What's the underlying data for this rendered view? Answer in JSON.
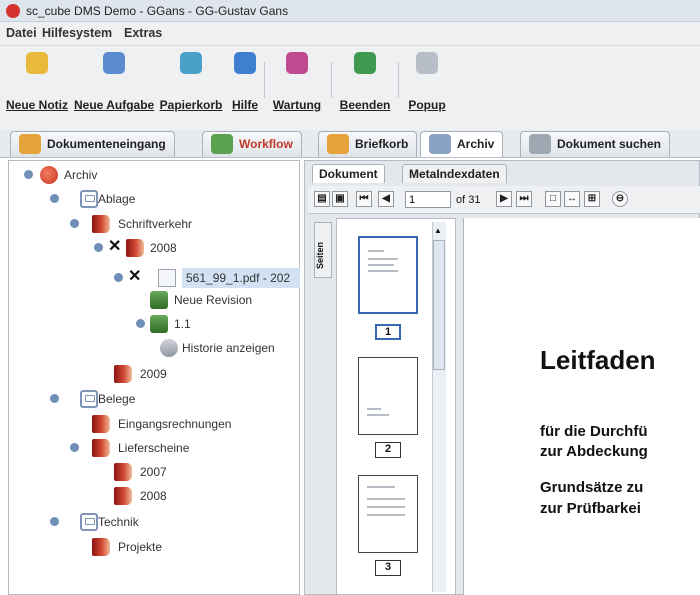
{
  "window": {
    "title": "sc_cube DMS Demo - GGans - GG-Gustav Gans"
  },
  "menu": [
    "Datei",
    "Hilfesystem",
    "Extras"
  ],
  "toolbar": {
    "buttons": [
      {
        "label": "Neue Notiz",
        "icon": "note-icon",
        "color": "#e8b93a"
      },
      {
        "label": "Neue Aufgabe",
        "icon": "task-icon",
        "color": "#5a8bd0"
      },
      {
        "label": "Papierkorb",
        "icon": "trash-icon",
        "color": "#4aa0c8"
      },
      {
        "label": "Hilfe",
        "icon": "help-icon",
        "color": "#3f7fd0"
      },
      {
        "label": "Wartung",
        "icon": "maintenance-icon",
        "color": "#c04a8f"
      },
      {
        "label": "Beenden",
        "icon": "exit-icon",
        "color": "#3f9a4f"
      },
      {
        "label": "Popup",
        "icon": "popup-icon",
        "color": "#b8bec8"
      }
    ]
  },
  "tabs": [
    {
      "label": "Dokumenteneingang",
      "icon": "inbox-icon",
      "color": "#e4a23a"
    },
    {
      "label": "Workflow",
      "icon": "workflow-icon",
      "color": "#5ca14d"
    },
    {
      "label": "Briefkorb",
      "icon": "letterbox-icon",
      "color": "#e7a13a"
    },
    {
      "label": "Archiv",
      "icon": "archive-icon",
      "color": "#8aa3c5"
    },
    {
      "label": "Dokument suchen",
      "icon": "search-icon",
      "color": "#9ea8b3"
    }
  ],
  "tree": {
    "nodes": [
      {
        "label": "Archiv",
        "icon": "root",
        "expander": true
      },
      {
        "label": "Ablage",
        "icon": "box",
        "expander": true
      },
      {
        "label": "Schriftverkehr",
        "icon": "folder",
        "expander": true
      },
      {
        "label": "2008",
        "icon": "folder",
        "expander": true,
        "mark": "✕"
      },
      {
        "label": "561_99_1.pdf - 202",
        "icon": "doc",
        "expander": true,
        "mark": "✕",
        "selected": true
      },
      {
        "label": "Neue Revision",
        "icon": "rev"
      },
      {
        "label": "1.1",
        "icon": "rev",
        "expander": true
      },
      {
        "label": "Historie anzeigen",
        "icon": "hist"
      },
      {
        "label": "2009",
        "icon": "folder"
      },
      {
        "label": "Belege",
        "icon": "box",
        "expander": true
      },
      {
        "label": "Eingangsrechnungen",
        "icon": "folder"
      },
      {
        "label": "Lieferscheine",
        "icon": "folder",
        "expander": true
      },
      {
        "label": "2007",
        "icon": "folder"
      },
      {
        "label": "2008",
        "icon": "folder"
      },
      {
        "label": "Technik",
        "icon": "box",
        "expander": true
      },
      {
        "label": "Projekte",
        "icon": "folder"
      }
    ]
  },
  "viewer": {
    "tabs": [
      "Dokument",
      "MetaIndexdaten"
    ],
    "page_input": "1",
    "page_of": "of 31",
    "side_tab": "Seiten",
    "thumbnails": [
      "1",
      "2",
      "3"
    ],
    "selected_page": "1",
    "doc": {
      "heading": "Leitfaden",
      "lines": [
        "für die Durchfü",
        "zur Abdeckung",
        "Grundsätze zu",
        "zur Prüfbarkei"
      ]
    }
  }
}
